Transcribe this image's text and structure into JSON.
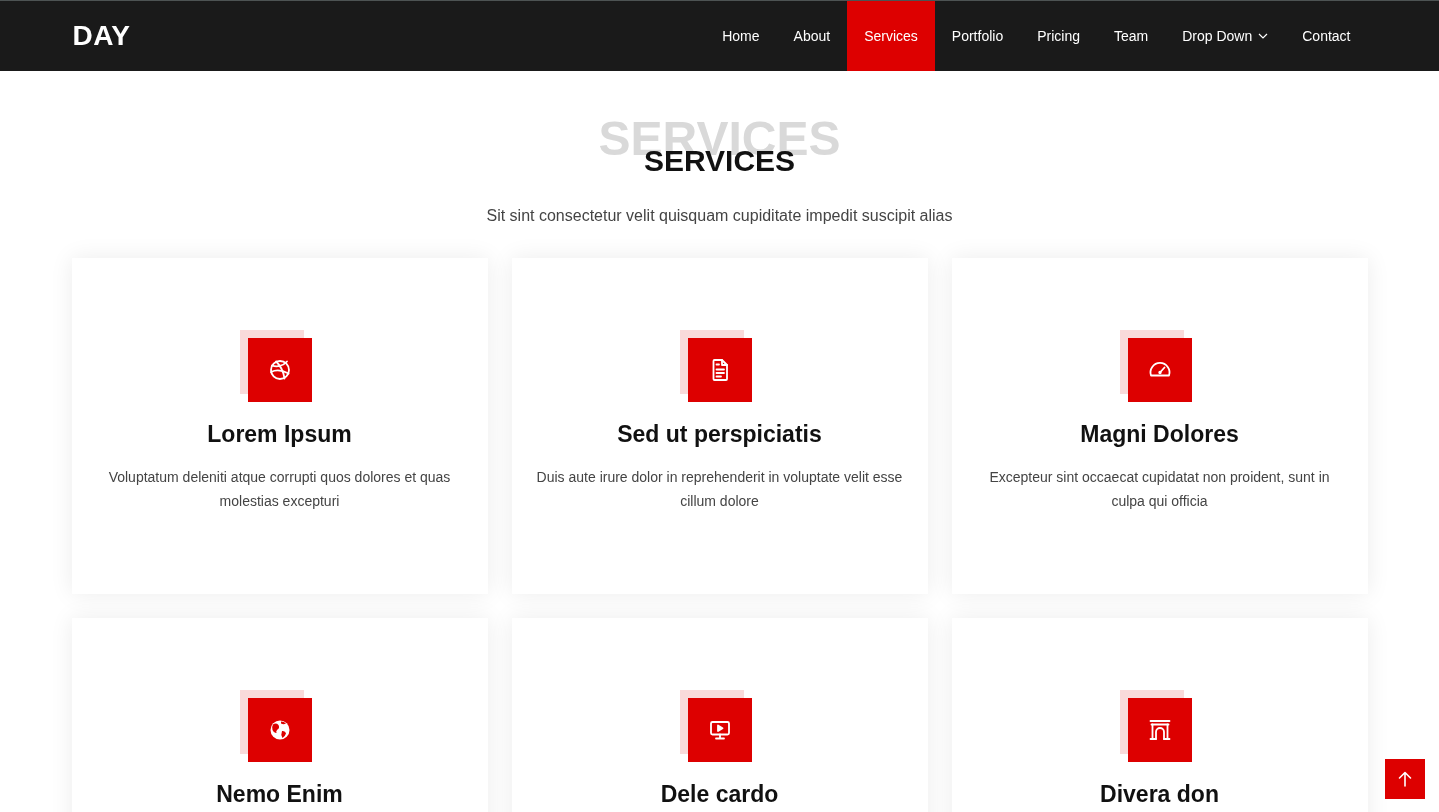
{
  "header": {
    "logo": "DAY",
    "nav": [
      {
        "label": "Home",
        "kind": "link",
        "selected": false
      },
      {
        "label": "About",
        "kind": "link",
        "selected": false
      },
      {
        "label": "Services",
        "kind": "link",
        "selected": true
      },
      {
        "label": "Portfolio",
        "kind": "link",
        "selected": false
      },
      {
        "label": "Pricing",
        "kind": "link",
        "selected": false
      },
      {
        "label": "Team",
        "kind": "link",
        "selected": false
      },
      {
        "label": "Drop Down",
        "kind": "dropdown",
        "selected": false
      },
      {
        "label": "Contact",
        "kind": "link",
        "selected": false
      }
    ]
  },
  "services": {
    "title_backdrop": "SERVICES",
    "title": "SERVICES",
    "subtitle": "Sit sint consectetur velit quisquam cupiditate impedit suscipit alias",
    "cards": [
      {
        "title": "Lorem Ipsum",
        "description": "Voluptatum deleniti atque corrupti quos dolores et quas molestias excepturi"
      },
      {
        "title": "Sed ut perspiciatis",
        "description": "Duis aute irure dolor in reprehenderit in voluptate velit esse cillum dolore"
      },
      {
        "title": "Magni Dolores",
        "description": "Excepteur sint occaecat cupidatat non proident, sunt in culpa qui officia"
      },
      {
        "title": "Nemo Enim"
      },
      {
        "title": "Dele cardo"
      },
      {
        "title": "Divera don"
      }
    ]
  }
}
